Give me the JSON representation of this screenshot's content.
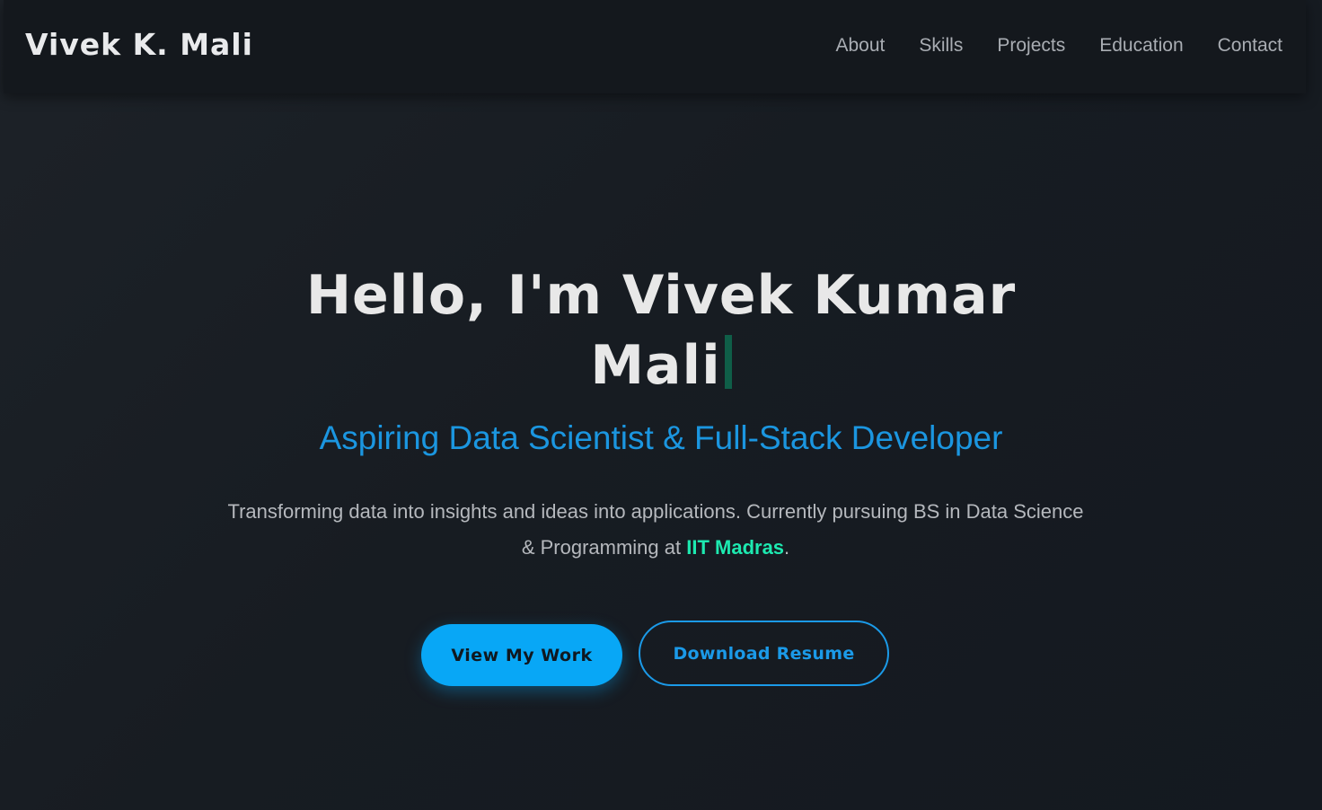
{
  "nav": {
    "brand": "Vivek K. Mali",
    "links": [
      "About",
      "Skills",
      "Projects",
      "Education",
      "Contact"
    ]
  },
  "hero": {
    "headline_line1": "Hello, I'm Vivek Kumar",
    "headline_line2": "Mali",
    "subtitle": "Aspiring Data Scientist & Full-Stack Developer",
    "description_part1": "Transforming data into insights and ideas into applications. Currently pursuing BS in Data Science & Programming at ",
    "description_highlight": "IIT Madras",
    "description_part2": ".",
    "primary_button": "View My Work",
    "secondary_button": "Download Resume"
  },
  "colors": {
    "accent_blue": "#08a7f6",
    "accent_green": "#1de9b0",
    "cursor": "#0f5e48",
    "background": "#171c22"
  }
}
